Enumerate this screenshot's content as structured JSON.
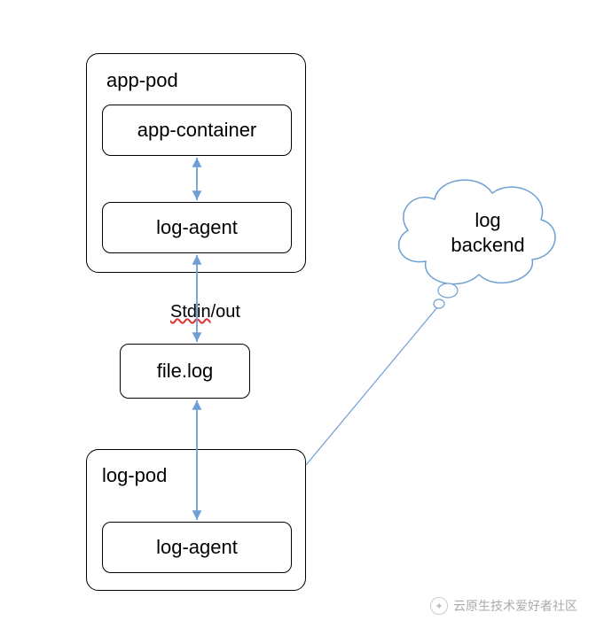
{
  "appPod": {
    "title": "app-pod",
    "container": "app-container",
    "logAgent": "log-agent"
  },
  "stdinOut": {
    "stdin": "Stdin",
    "out": "/out"
  },
  "fileLog": "file.log",
  "logPod": {
    "title": "log-pod",
    "logAgent": "log-agent"
  },
  "backend": {
    "line1": "log",
    "line2": "backend"
  },
  "watermark": "云原生技术爱好者社区"
}
